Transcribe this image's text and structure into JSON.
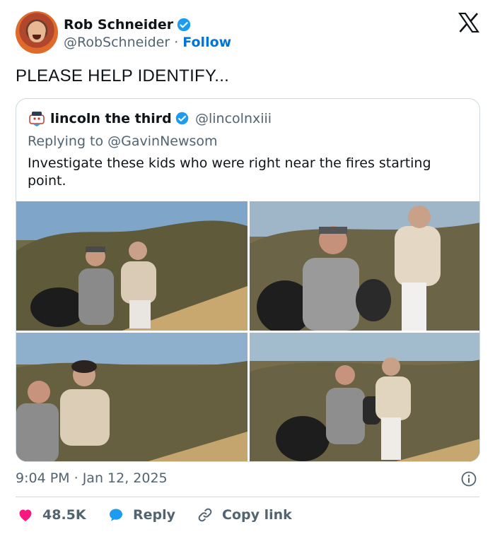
{
  "author": {
    "name": "Rob Schneider",
    "handle": "@RobSchneider",
    "separator": "·",
    "follow_label": "Follow"
  },
  "tweet": {
    "text": "PLEASE HELP IDENTIFY...",
    "time": "9:04 PM",
    "date": "Jan 12, 2025"
  },
  "quote": {
    "name": "lincoln the third",
    "handle": "@lincolnxiii",
    "replying_prefix": "Replying to ",
    "replying_to": "@GavinNewsom",
    "text": "Investigate these kids who were right near the fires starting point."
  },
  "actions": {
    "like_count": "48.5K",
    "reply_label": "Reply",
    "copy_label": "Copy link"
  },
  "icons": {
    "verified": "verified-badge-icon",
    "logo": "x-logo-icon",
    "info": "info-icon",
    "like": "heart-icon",
    "reply": "speech-bubble-icon",
    "copy": "link-icon"
  },
  "colors": {
    "verified_blue": "#1d9bf0",
    "follow_blue": "#0074d9",
    "like_red": "#f91880",
    "muted_gray": "#536471"
  }
}
